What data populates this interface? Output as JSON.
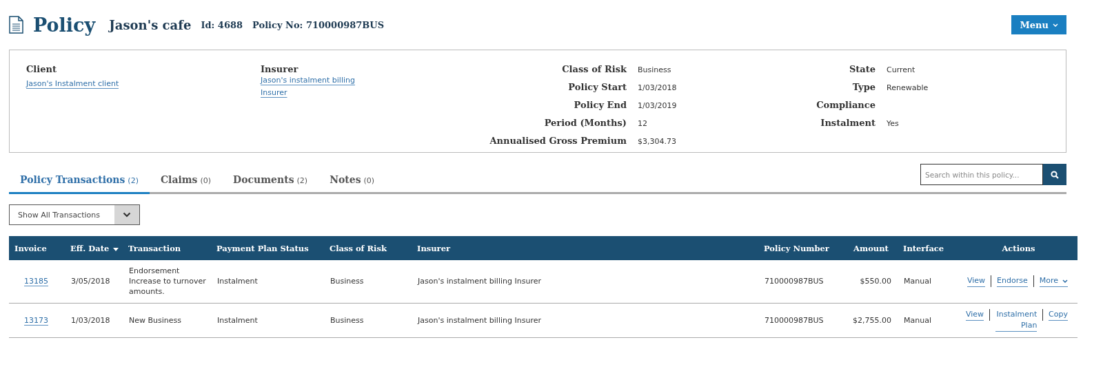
{
  "header": {
    "title": "Policy",
    "client": "Jason's cafe",
    "id": "Id: 4688",
    "policy_no": "Policy No: 710000987BUS",
    "menu_button": "Menu"
  },
  "summary": {
    "client": {
      "label": "Client",
      "link": "Jason's Instalment client"
    },
    "insurer": {
      "label": "Insurer",
      "link": "Jason's instalment billing Insurer"
    },
    "details_left": [
      {
        "label": "Class of Risk",
        "value": "Business"
      },
      {
        "label": "Policy Start",
        "value": "1/03/2018"
      },
      {
        "label": "Policy End",
        "value": "1/03/2019"
      },
      {
        "label": "Period (Months)",
        "value": "12"
      },
      {
        "label": "Annualised Gross Premium",
        "value": "$3,304.73"
      }
    ],
    "details_right": [
      {
        "label": "State",
        "value": "Current"
      },
      {
        "label": "Type",
        "value": "Renewable"
      },
      {
        "label": "Compliance"
      },
      {
        "label": "Instalment",
        "value": "Yes"
      }
    ]
  },
  "tabs": [
    {
      "label": "Policy Transactions",
      "count": "(2)",
      "selected": true
    },
    {
      "label": "Claims",
      "count": "(0)",
      "selected": false
    },
    {
      "label": "Documents",
      "count": "(2)",
      "selected": false
    },
    {
      "label": "Notes",
      "count": "(0)",
      "selected": false
    }
  ],
  "search": {
    "placeholder": "Search within this policy..."
  },
  "filter": {
    "value": "Show All Transactions"
  },
  "table": {
    "columns": [
      {
        "label": "Invoice",
        "sorted": false
      },
      {
        "label": "Eff. Date",
        "sorted": true
      },
      {
        "label": "Transaction",
        "sorted": false
      },
      {
        "label": "Payment Plan Status",
        "sorted": false
      },
      {
        "label": "Class of Risk",
        "sorted": false
      },
      {
        "label": "Insurer",
        "sorted": false
      },
      {
        "label": "Policy Number",
        "sorted": false
      },
      {
        "label": "Amount",
        "sorted": false
      },
      {
        "label": "Interface",
        "sorted": false
      },
      {
        "label": "Actions",
        "sorted": false
      }
    ],
    "rows": [
      {
        "invoice": "13185",
        "date": "3/05/2018",
        "transaction": [
          "Endorsement",
          "Increase to turnover amounts."
        ],
        "status": "Instalment",
        "class": "Business",
        "insurer": "Jason's instalment billing Insurer",
        "policy_number": "710000987BUS",
        "amount": "$550.00",
        "interface": "Manual",
        "actions": [
          {
            "label": "View",
            "kind": "link"
          },
          {
            "label": "Endorse",
            "kind": "link"
          },
          {
            "label": "More",
            "kind": "menu"
          }
        ]
      },
      {
        "invoice": "13173",
        "date": "1/03/2018",
        "transaction": [
          "New Business"
        ],
        "status": "Instalment",
        "class": "Business",
        "insurer": "Jason's instalment billing Insurer",
        "policy_number": "710000987BUS",
        "amount": "$2,755.00",
        "interface": "Manual",
        "actions": [
          {
            "label": "View",
            "kind": "link"
          },
          {
            "label": "Instalment Plan",
            "kind": "link"
          },
          {
            "label": "Copy",
            "kind": "link"
          }
        ]
      }
    ]
  }
}
